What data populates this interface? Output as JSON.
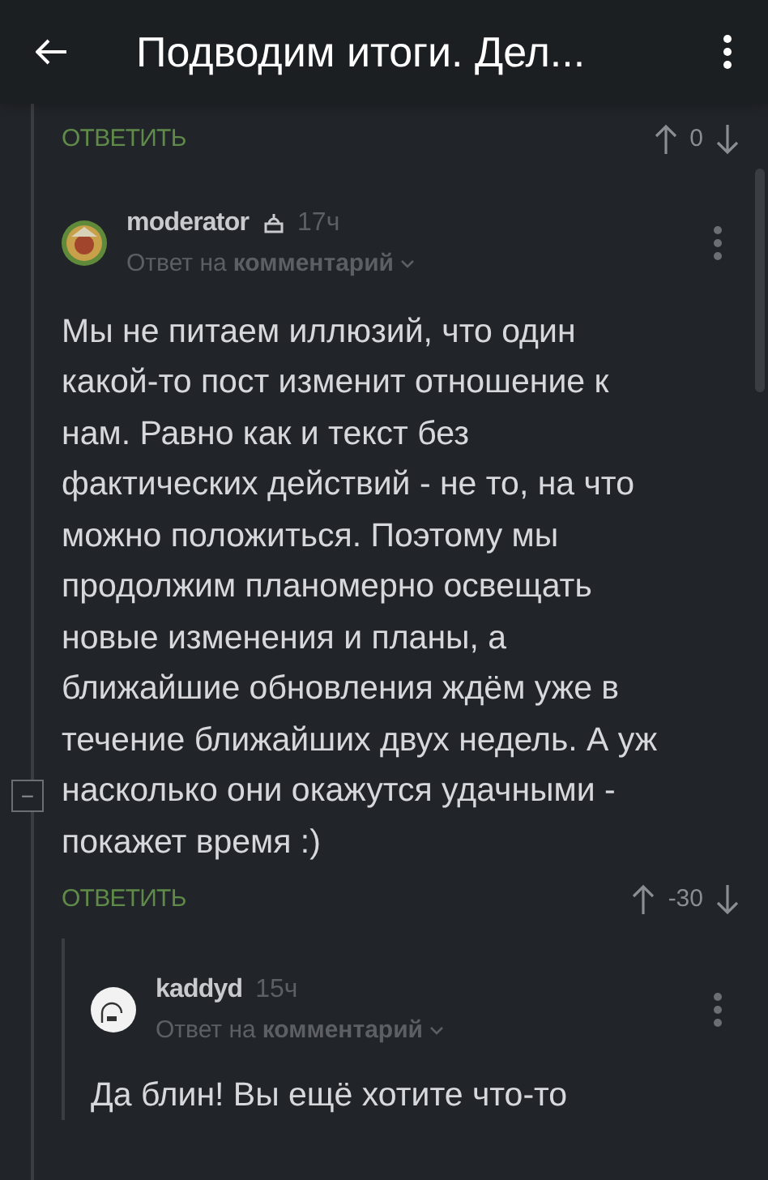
{
  "header": {
    "title": "Подводим итоги. Дел..."
  },
  "comments": [
    {
      "kind": "tail",
      "reply_label": "ОТВЕТИТЬ",
      "score": "0"
    },
    {
      "kind": "full",
      "author": "moderator",
      "moderator": true,
      "time": "17ч",
      "reply_to_prefix": "Ответ на",
      "reply_to_link": "комментарий",
      "body": "Мы не питаем иллюзий, что один какой-то пост изменит отношение к нам. Равно как и текст без фактических действий - не то, на что можно положиться. Поэтому мы продолжим планомерно освещать новые изменения и планы, а ближайшие обновления ждём уже в течение ближайших двух недель. А уж насколько они окажутся удачными - покажет время :)",
      "reply_label": "ОТВЕТИТЬ",
      "score": "-30",
      "collapse": "−"
    },
    {
      "kind": "nested",
      "author": "kaddyd",
      "moderator": false,
      "time": "15ч",
      "reply_to_prefix": "Ответ на",
      "reply_to_link": "комментарий",
      "body": "Да блин! Вы ещё хотите что-то"
    }
  ]
}
